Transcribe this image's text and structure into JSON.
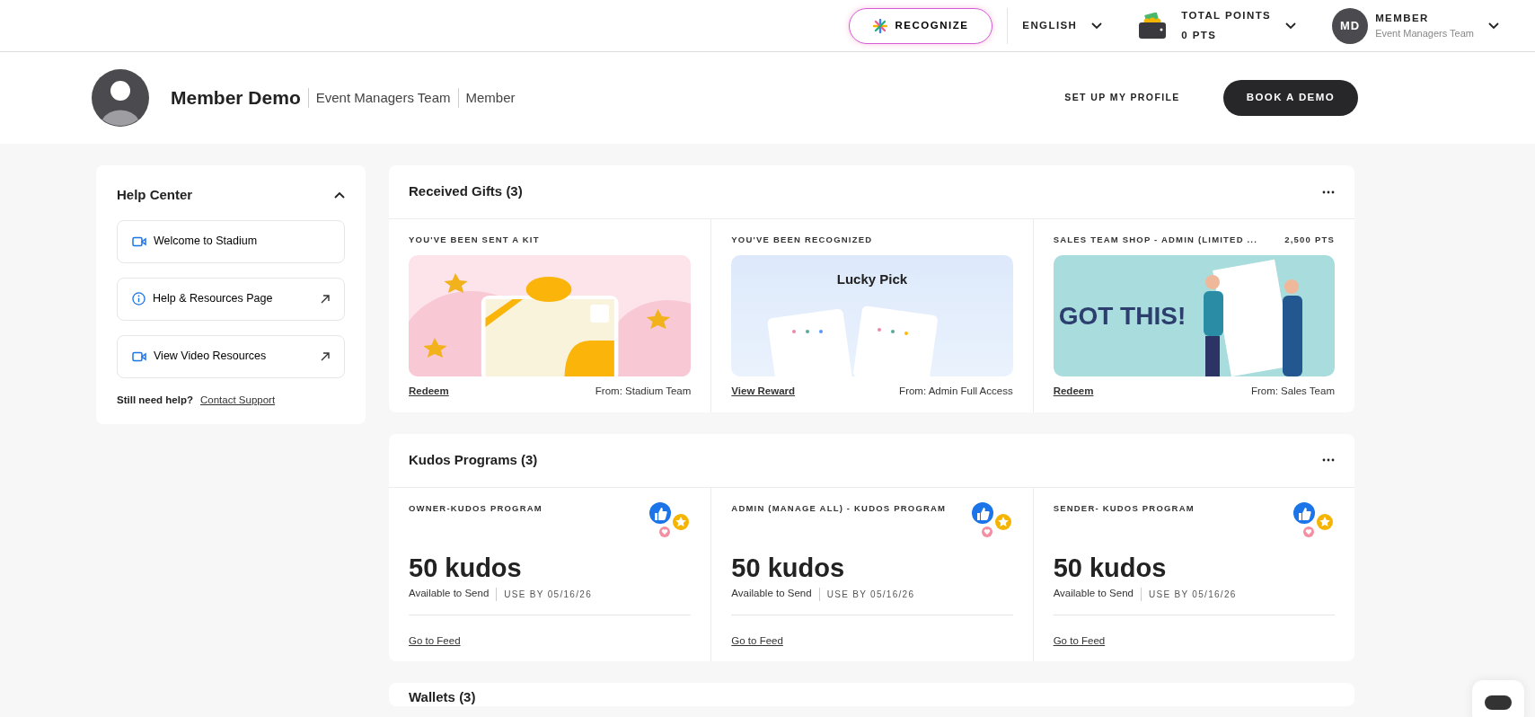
{
  "topbar": {
    "recognize": "RECOGNIZE",
    "language": "ENGLISH",
    "points_label": "TOTAL POINTS",
    "points_value": "0 PTS",
    "user_initials": "MD",
    "user_role": "MEMBER",
    "user_team": "Event Managers Team"
  },
  "profile": {
    "name": "Member Demo",
    "team": "Event Managers Team",
    "role": "Member",
    "setup_link": "SET UP MY PROFILE",
    "demo_button": "BOOK A DEMO"
  },
  "help_center": {
    "title": "Help Center",
    "expanded": true,
    "items": [
      {
        "kind": "video",
        "label": "Welcome to Stadium",
        "external": false
      },
      {
        "kind": "info",
        "label": "Help & Resources Page",
        "external": true
      },
      {
        "kind": "video",
        "label": "View Video Resources",
        "external": true
      }
    ],
    "footer_text": "Still need help?",
    "footer_link": "Contact Support"
  },
  "received_gifts": {
    "title": "Received Gifts (3)",
    "items": [
      {
        "label": "YOU'VE BEEN SENT A KIT",
        "kind": "gift",
        "action": "Redeem",
        "from": "From: Stadium Team"
      },
      {
        "label": "YOU'VE BEEN RECOGNIZED",
        "kind": "cards",
        "image_text": "Lucky Pick",
        "action": "View Reward",
        "from": "From: Admin Full Access"
      },
      {
        "label": "SALES TEAM SHOP - ADMIN (LIMITED ...",
        "points": "2,500 PTS",
        "kind": "banner",
        "image_text": "GOT THIS!",
        "action": "Redeem",
        "from": "From: Sales Team"
      }
    ]
  },
  "kudos_programs": {
    "title": "Kudos Programs (3)",
    "items": [
      {
        "program": "OWNER-KUDOS PROGRAM",
        "amount": "50 kudos",
        "available": "Available to Send",
        "use_by": "USE BY 05/16/26",
        "link": "Go to Feed"
      },
      {
        "program": "ADMIN (MANAGE ALL) - KUDOS PROGRAM",
        "amount": "50 kudos",
        "available": "Available to Send",
        "use_by": "USE BY 05/16/26",
        "link": "Go to Feed"
      },
      {
        "program": "SENDER- KUDOS PROGRAM",
        "amount": "50 kudos",
        "available": "Available to Send",
        "use_by": "USE BY 05/16/26",
        "link": "Go to Feed"
      }
    ]
  },
  "wallets": {
    "title": "Wallets (3)"
  }
}
